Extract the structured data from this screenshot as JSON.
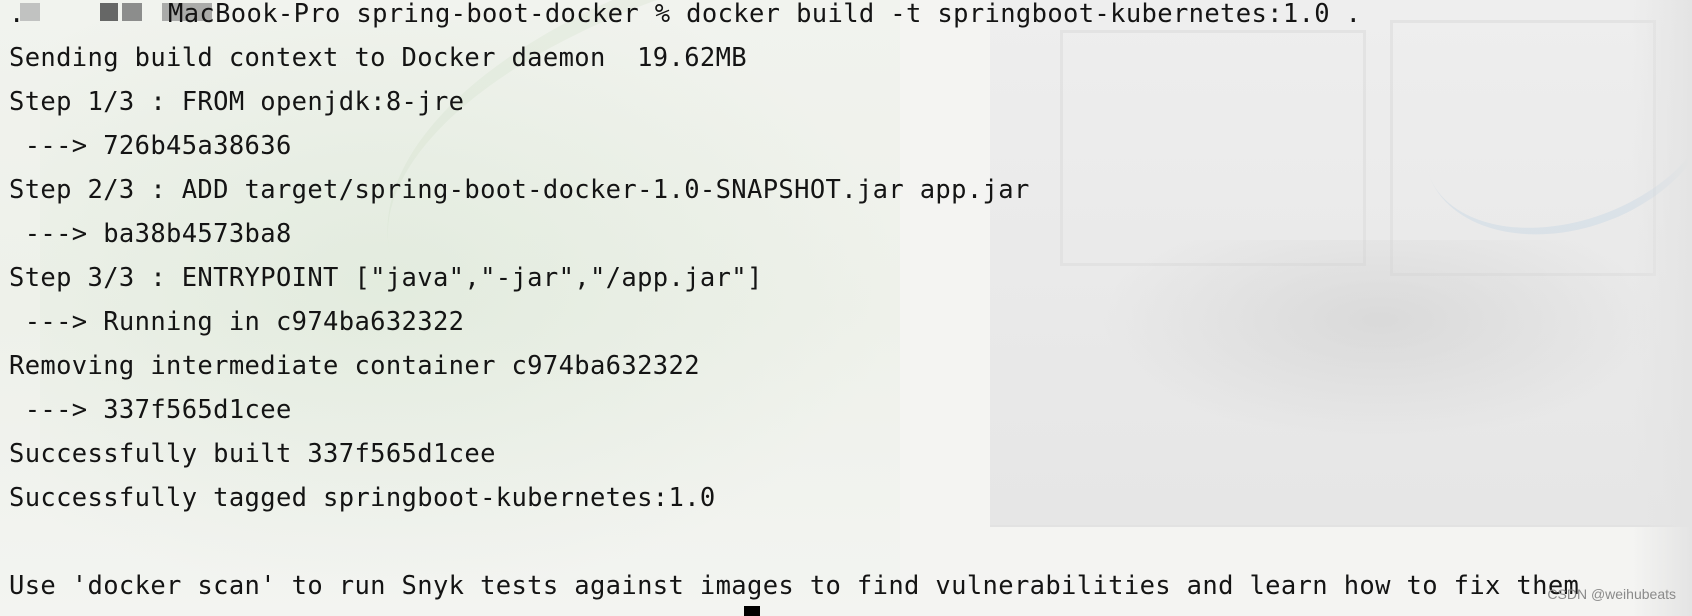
{
  "terminal": {
    "prompt": {
      "host_suffix": "MacBook-Pro",
      "directory": "spring-boot-docker",
      "symbol": "%",
      "command": "docker build -t springboot-kubernetes:1.0 ."
    },
    "prompt_line_rest": "MacBook-Pro spring-boot-docker % docker build -t springboot-kubernetes:1.0 .",
    "lines": [
      "Sending build context to Docker daemon  19.62MB",
      "Step 1/3 : FROM openjdk:8-jre",
      " ---> 726b45a38636",
      "Step 2/3 : ADD target/spring-boot-docker-1.0-SNAPSHOT.jar app.jar",
      " ---> ba38b4573ba8",
      "Step 3/3 : ENTRYPOINT [\"java\",\"-jar\",\"/app.jar\"]",
      " ---> Running in c974ba632322",
      "Removing intermediate container c974ba632322",
      " ---> 337f565d1cee",
      "Successfully built 337f565d1cee",
      "Successfully tagged springboot-kubernetes:1.0",
      "",
      "Use 'docker scan' to run Snyk tests against images to find vulnerabilities and learn how to fix them"
    ]
  },
  "watermark": "CSDN @weihubeats"
}
